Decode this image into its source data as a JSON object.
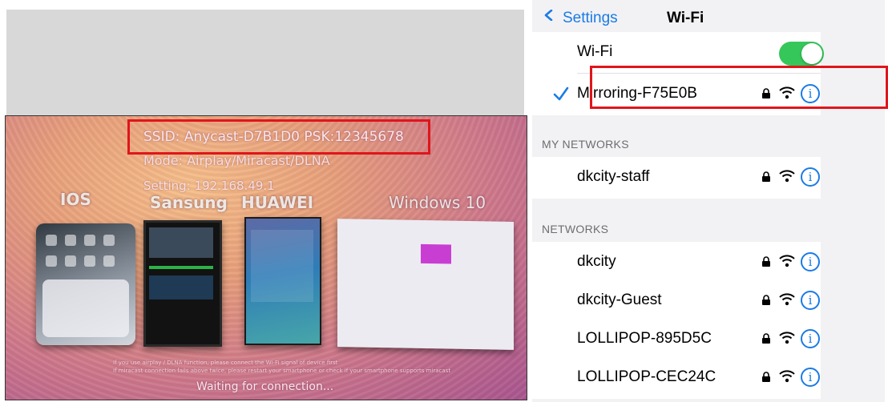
{
  "tv_screen": {
    "ssid_line": "SSID: Anycast-D7B1D0 PSK:12345678",
    "mode_line": "Mode: Airplay/Miracast/DLNA",
    "setting_line": "Setting: 192.168.49.1",
    "platforms": [
      "IOS",
      "Sansung",
      "HUAWEI",
      "Windows 10"
    ],
    "footer_line_1": "If you use airplay / DLNA function, please connect the Wi-Fi signal of device first",
    "footer_line_2": "If miracast connection fails above twice, please restart your smartphone or check if your smartphone supports miracast",
    "waiting_text": "Waiting for connection..."
  },
  "ios_wifi": {
    "nav": {
      "back_label": "Settings",
      "title": "Wi-Fi"
    },
    "wifi_toggle": {
      "label": "Wi-Fi",
      "on": true
    },
    "connected_network": {
      "name": "Mirroring-F75E0B",
      "secured": true
    },
    "my_networks": {
      "header": "MY NETWORKS",
      "items": [
        {
          "name": "dkcity-staff",
          "secured": true
        }
      ]
    },
    "networks": {
      "header": "NETWORKS",
      "items": [
        {
          "name": "dkcity",
          "secured": true
        },
        {
          "name": "dkcity-Guest",
          "secured": true
        },
        {
          "name": "LOLLIPOP-895D5C",
          "secured": true
        },
        {
          "name": "LOLLIPOP-CEC24C",
          "secured": true
        }
      ]
    },
    "info_glyph": "i"
  },
  "colors": {
    "ios_blue": "#1b7be5",
    "toggle_green": "#35c759",
    "highlight_red": "#e0151b",
    "grouped_background": "#f2f2f4"
  },
  "icons": [
    "chevron-left-icon",
    "checkmark-icon",
    "lock-icon",
    "wifi-icon",
    "info-icon"
  ]
}
